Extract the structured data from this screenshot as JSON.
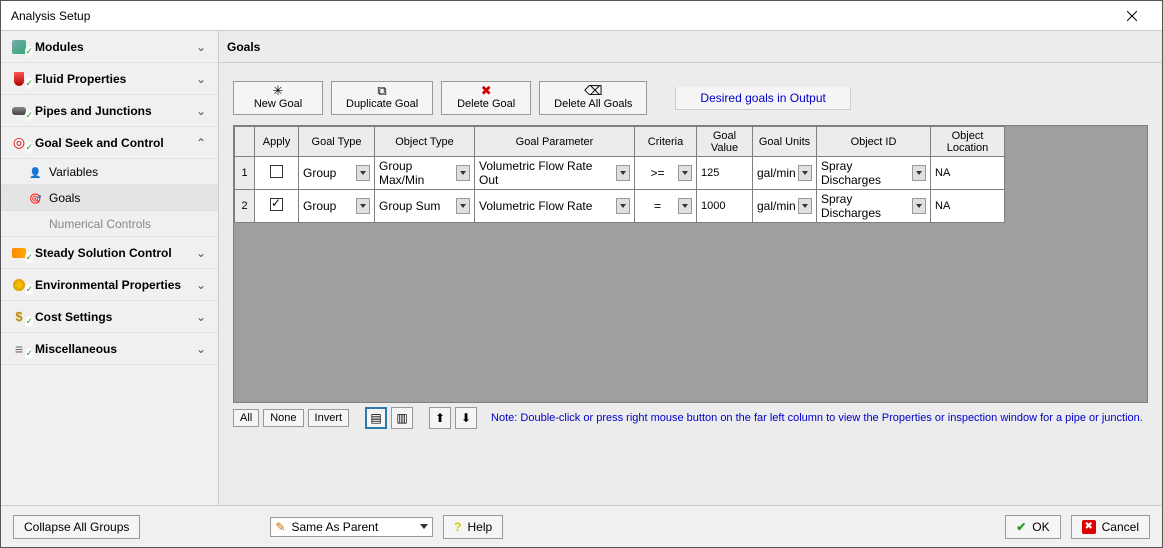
{
  "window": {
    "title": "Analysis Setup"
  },
  "sidebar": {
    "items": [
      {
        "label": "Modules",
        "expand": "⌄"
      },
      {
        "label": "Fluid Properties",
        "expand": "⌄"
      },
      {
        "label": "Pipes and Junctions",
        "expand": "⌄"
      },
      {
        "label": "Goal Seek and Control",
        "expand": "⌃"
      },
      {
        "label": "Steady Solution Control",
        "expand": "⌄"
      },
      {
        "label": "Environmental Properties",
        "expand": "⌄"
      },
      {
        "label": "Cost Settings",
        "expand": "⌄"
      },
      {
        "label": "Miscellaneous",
        "expand": "⌄"
      }
    ],
    "subs": {
      "variables": "Variables",
      "goals": "Goals",
      "numerical": "Numerical Controls"
    }
  },
  "content": {
    "header": "Goals",
    "toolbar": {
      "new": "New Goal",
      "duplicate": "Duplicate Goal",
      "delete": "Delete Goal",
      "deleteAll": "Delete All Goals",
      "link": "Desired goals in Output"
    },
    "grid": {
      "headers": [
        "",
        "Apply",
        "Goal Type",
        "Object Type",
        "Goal Parameter",
        "Criteria",
        "Goal Value",
        "Goal Units",
        "Object ID",
        "Object Location"
      ],
      "rows": [
        {
          "n": "1",
          "apply": false,
          "goalType": "Group",
          "objType": "Group Max/Min",
          "param": "Volumetric Flow Rate Out",
          "criteria": ">=",
          "value": "125",
          "units": "gal/min",
          "objId": "Spray Discharges",
          "objLoc": "NA"
        },
        {
          "n": "2",
          "apply": true,
          "goalType": "Group",
          "objType": "Group Sum",
          "param": "Volumetric Flow Rate",
          "criteria": "=",
          "value": "1000",
          "units": "gal/min",
          "objId": "Spray Discharges",
          "objLoc": "NA"
        }
      ]
    },
    "bottombar": {
      "all": "All",
      "none": "None",
      "invert": "Invert",
      "note": "Note: Double-click or press right mouse button on the far left column to view the Properties or inspection window for a pipe or junction."
    }
  },
  "footer": {
    "collapse": "Collapse All Groups",
    "sameAsParent": "Same As Parent",
    "help": "Help",
    "ok": "OK",
    "cancel": "Cancel"
  },
  "chart_data": {
    "type": "table",
    "title": "Goals",
    "columns": [
      "Apply",
      "Goal Type",
      "Object Type",
      "Goal Parameter",
      "Criteria",
      "Goal Value",
      "Goal Units",
      "Object ID",
      "Object Location"
    ],
    "rows": [
      [
        false,
        "Group",
        "Group Max/Min",
        "Volumetric Flow Rate Out",
        ">=",
        125,
        "gal/min",
        "Spray Discharges",
        "NA"
      ],
      [
        true,
        "Group",
        "Group Sum",
        "Volumetric Flow Rate",
        "=",
        1000,
        "gal/min",
        "Spray Discharges",
        "NA"
      ]
    ]
  }
}
